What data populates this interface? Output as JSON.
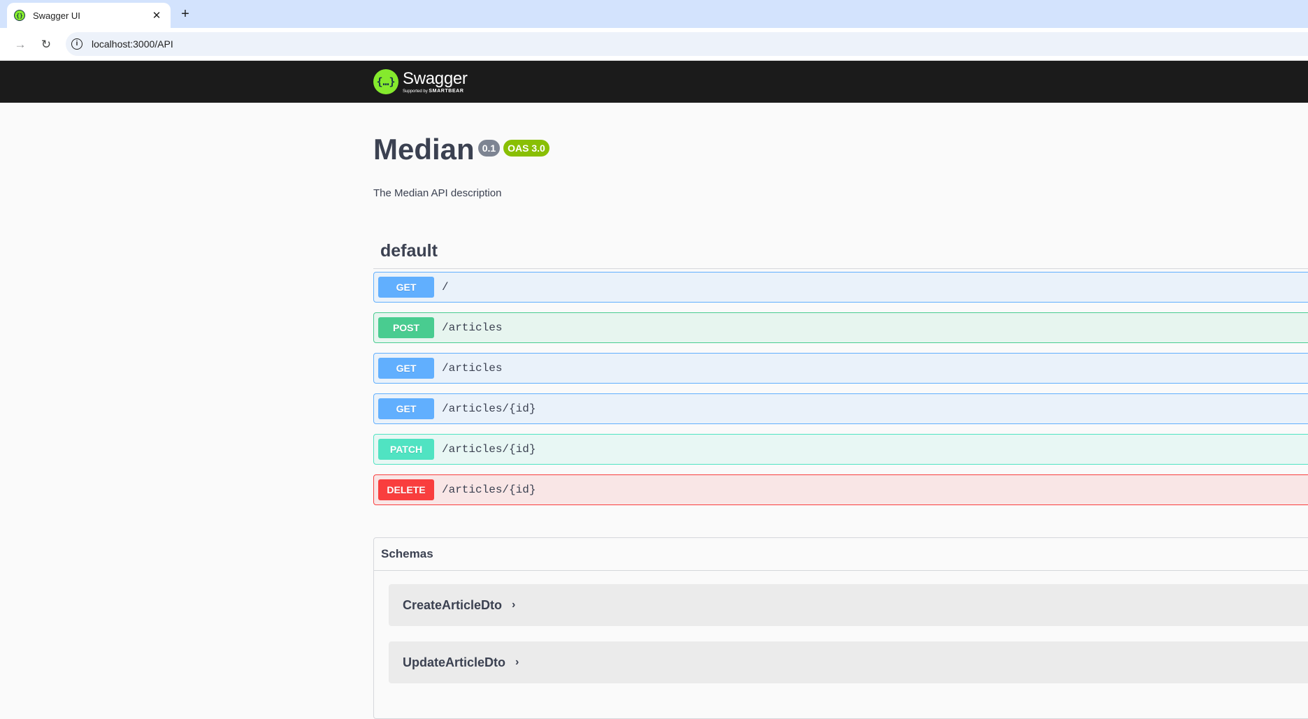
{
  "browser": {
    "tab_title": "Swagger UI",
    "tab_close": "✕",
    "new_tab": "+",
    "url": "localhost:3000/API"
  },
  "topbar": {
    "logo_word": "Swagger",
    "logo_supported": "Supported by",
    "logo_brand": "SMARTBEAR"
  },
  "info": {
    "title": "Median",
    "version": "0.1",
    "oas": "OAS 3.0",
    "description": "The Median API description"
  },
  "tag": {
    "name": "default",
    "operations": [
      {
        "method": "GET",
        "path": "/"
      },
      {
        "method": "POST",
        "path": "/articles"
      },
      {
        "method": "GET",
        "path": "/articles"
      },
      {
        "method": "GET",
        "path": "/articles/{id}"
      },
      {
        "method": "PATCH",
        "path": "/articles/{id}"
      },
      {
        "method": "DELETE",
        "path": "/articles/{id}"
      }
    ]
  },
  "schemas": {
    "title": "Schemas",
    "models": [
      "CreateArticleDto",
      "UpdateArticleDto"
    ],
    "toggle": "›"
  },
  "colors": {
    "get": "#61affe",
    "post": "#49cc90",
    "patch": "#50e3c2",
    "delete": "#f93e3e",
    "topbar": "#1b1b1b",
    "logo": "#85ea2d"
  }
}
